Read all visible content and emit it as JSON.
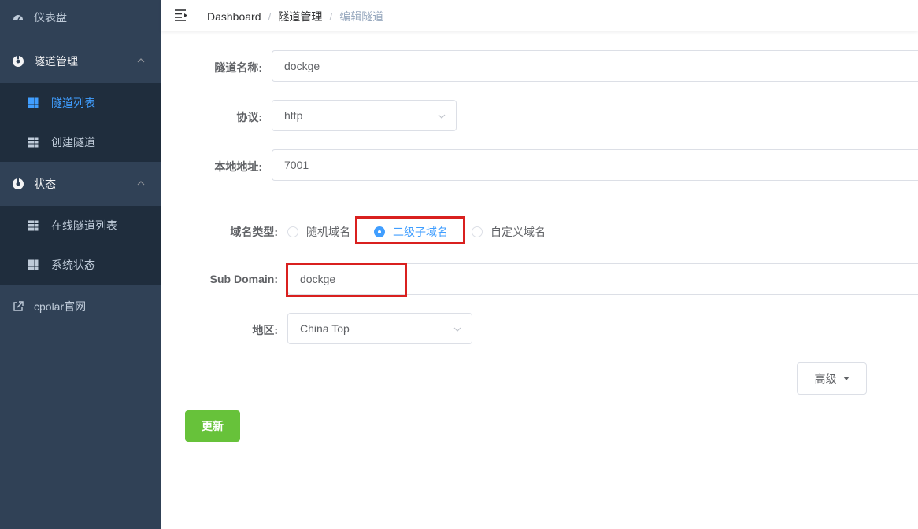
{
  "sidebar": {
    "dashboard": "仪表盘",
    "tunnel_mgmt": "隧道管理",
    "tunnel_list": "隧道列表",
    "create_tunnel": "创建隧道",
    "status": "状态",
    "online_tunnels": "在线隧道列表",
    "system_status": "系统状态",
    "cpolar_site": "cpolar官网"
  },
  "breadcrumb": {
    "home": "Dashboard",
    "section": "隧道管理",
    "current": "编辑隧道",
    "sep": "/"
  },
  "form": {
    "name_label": "隧道名称:",
    "name_value": "dockge",
    "protocol_label": "协议:",
    "protocol_value": "http",
    "local_label": "本地地址:",
    "local_value": "7001",
    "domain_type_label": "域名类型:",
    "domain_options": [
      "随机域名",
      "二级子域名",
      "自定义域名"
    ],
    "subdomain_label": "Sub Domain:",
    "subdomain_value": "dockge",
    "region_label": "地区:",
    "region_value": "China Top",
    "advanced": "高级",
    "update": "更新"
  },
  "colors": {
    "sidebar_bg": "#304156",
    "submenu_bg": "#1f2d3d",
    "accent": "#409eff",
    "success": "#67c23a",
    "highlight": "#d9201f"
  }
}
